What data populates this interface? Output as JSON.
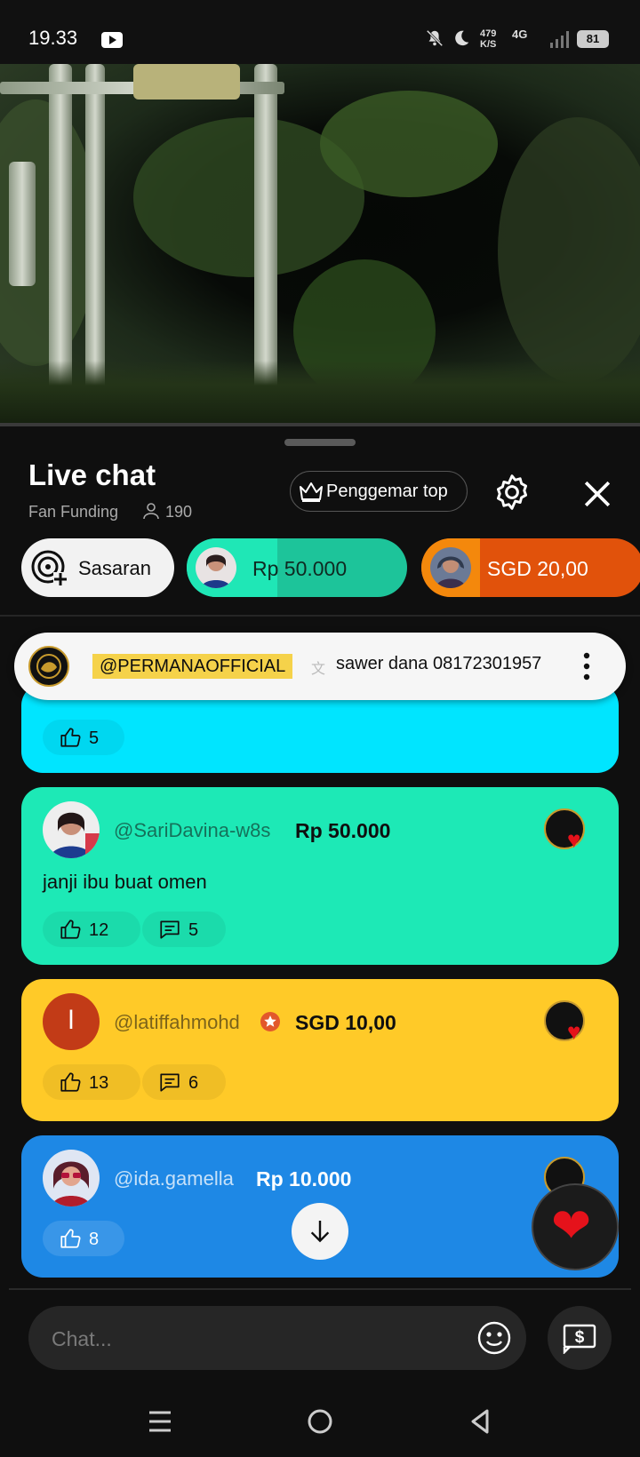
{
  "status_bar": {
    "time": "19.33",
    "net_speed": "479\nK/S",
    "net_type": "4G",
    "battery": "81"
  },
  "chat": {
    "title": "Live chat",
    "subtitle": "Fan Funding",
    "viewer_count": "190",
    "top_fans_label": "Penggemar top",
    "input_placeholder": "Chat..."
  },
  "chips": {
    "goal_label": "Sasaran",
    "rp_amount": "Rp 50.000",
    "sgd_amount": "SGD 20,00"
  },
  "pinned": {
    "user": "@PERMANAOFFICIAL",
    "text": "sawer dana 08172301957"
  },
  "messages": [
    {
      "likes": "5"
    },
    {
      "user": "@SariDavina-w8s",
      "amount": "Rp 50.000",
      "text": "janji ibu buat omen",
      "likes": "12",
      "replies": "5"
    },
    {
      "user": "@latiffahmohd",
      "initial": "l",
      "amount": "SGD 10,00",
      "likes": "13",
      "replies": "6"
    },
    {
      "user": "@ida.gamella",
      "amount": "Rp 10.000",
      "likes": "8"
    }
  ],
  "colors": {
    "msg0_bg": "#00e5ff",
    "msg1_bg": "#1de9b6",
    "msg2_bg": "#ffca28",
    "msg3_bg": "#1e88e5",
    "chip_rp": "#1dc49a",
    "chip_sgd": "#e1520b",
    "pinned_highlight": "#f5d24a",
    "heart": "#e5121b"
  },
  "icons": [
    "youtube-icon",
    "mute-icon",
    "moon-icon",
    "signal-icon",
    "battery-icon",
    "crown-icon",
    "gear-icon",
    "close-icon",
    "goal-icon",
    "translate-icon",
    "more-vert-icon",
    "thumb-up-icon",
    "reply-icon",
    "verified-star-icon",
    "heart-icon",
    "arrow-down-icon",
    "emoji-icon",
    "superchat-icon",
    "menu-icon",
    "home-icon",
    "back-icon"
  ]
}
